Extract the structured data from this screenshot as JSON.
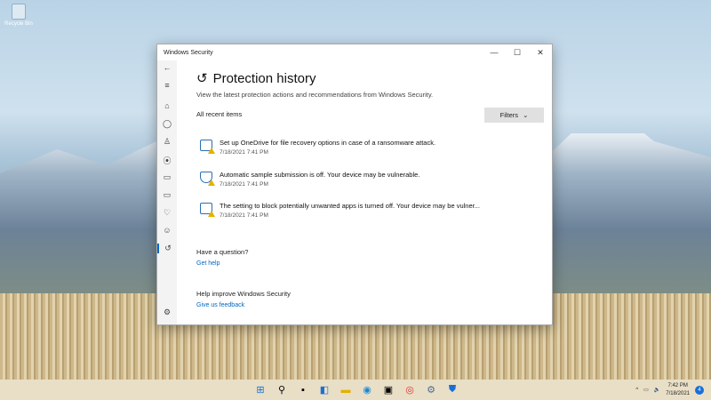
{
  "desktop": {
    "recycle_bin": "Recycle Bin"
  },
  "window": {
    "title": "Windows Security",
    "minimize": "—",
    "maximize": "☐",
    "close": "✕"
  },
  "page": {
    "title": "Protection history",
    "subtitle": "View the latest protection actions and recommendations from Windows Security.",
    "section": "All recent items",
    "filters": "Filters"
  },
  "items": [
    {
      "text": "Set up OneDrive for file recovery options in case of a ransomware attack.",
      "time": "7/18/2021 7:41 PM"
    },
    {
      "text": "Automatic sample submission is off. Your device may be vulnerable.",
      "time": "7/18/2021 7:41 PM"
    },
    {
      "text": "The setting to block potentially unwanted apps is turned off. Your device may be vulner...",
      "time": "7/18/2021 7:41 PM"
    }
  ],
  "help": {
    "question": "Have a question?",
    "get_help": "Get help",
    "improve": "Help improve Windows Security",
    "feedback": "Give us feedback"
  },
  "taskbar": {
    "time": "7:42 PM",
    "date": "7/18/2021",
    "notifications": "4"
  }
}
